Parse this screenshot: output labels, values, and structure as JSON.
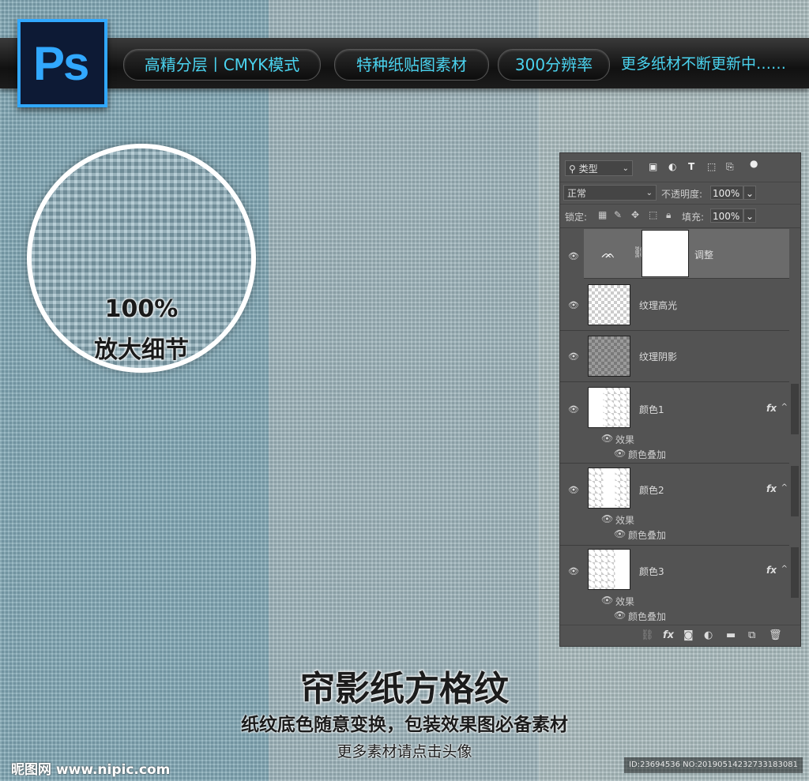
{
  "logo": {
    "text": "Ps",
    "color": "#31a8ff"
  },
  "topbar": {
    "pills": [
      "高精分层丨CMYK模式",
      "特种纸贴图素材",
      "300分辨率"
    ],
    "more": "更多纸材不断更新中……",
    "accent": "#4ad3ef"
  },
  "magnifier": {
    "line1": "100%",
    "line2": "放大细节"
  },
  "panel": {
    "filter_label": "类型",
    "filter_icons": [
      "image-icon",
      "adjustment-icon",
      "text-icon",
      "shape-icon",
      "smart-object-icon",
      "toggle-icon"
    ],
    "blend_mode": "正常",
    "opacity_label": "不透明度:",
    "opacity_value": "100%",
    "lock_label": "锁定:",
    "fill_label": "填充:",
    "fill_value": "100%",
    "layers": [
      {
        "name": "调整",
        "selected": true,
        "type": "levels-adjustment"
      },
      {
        "name": "纹理高光"
      },
      {
        "name": "纹理阴影"
      },
      {
        "name": "颜色1",
        "fx": "fx",
        "effects_label": "效果",
        "effect": "颜色叠加"
      },
      {
        "name": "颜色2",
        "fx": "fx",
        "effects_label": "效果",
        "effect": "颜色叠加"
      },
      {
        "name": "颜色3",
        "fx": "fx",
        "effects_label": "效果",
        "effect": "颜色叠加"
      }
    ],
    "bottom_icons": [
      "link-icon",
      "fx-icon",
      "mask-icon",
      "adjustment-icon",
      "folder-icon",
      "new-layer-icon",
      "trash-icon"
    ]
  },
  "title": "帘影纸方格纹",
  "subtitle": "纸纹底色随意变换，包装效果图必备素材",
  "subtitle2": "更多素材请点击头像",
  "watermark": "昵图网 www.nipic.com",
  "id_text": "ID:23694536 NO:20190514232733183081"
}
